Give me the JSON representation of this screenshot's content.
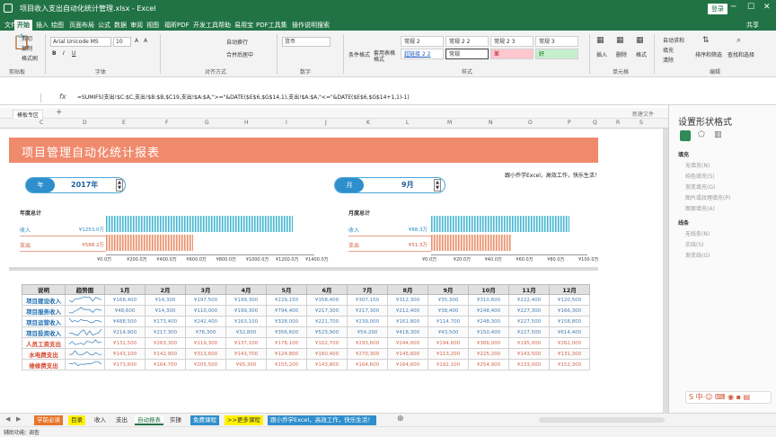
{
  "window": {
    "title": "项目收入支出自动化统计管理.xlsx  -  Excel",
    "login": "登录"
  },
  "tabs": [
    "文件",
    "开始",
    "插入",
    "绘图",
    "页面布局",
    "公式",
    "数据",
    "审阅",
    "视图",
    "福昕PDF",
    "开发工具",
    "帮助",
    "易用宝",
    "PDF工具集",
    "操作说明搜索"
  ],
  "tab_share": "共享",
  "ribbon": {
    "clipboard": {
      "cut": "剪切",
      "copy": "复制",
      "painter": "格式刷",
      "label": "剪贴板"
    },
    "font": {
      "name": "Arial Unicode MS",
      "size": "10",
      "label": "字体"
    },
    "align": {
      "wrap": "自动换行",
      "merge": "合并后居中",
      "label": "对齐方式"
    },
    "number": {
      "format": "货币",
      "label": "数字"
    },
    "styles": {
      "cond": "条件格式",
      "table": "套用表格格式",
      "cells": [
        [
          "常规 2",
          "常规 2 2",
          "常规 2 3",
          "常规 3"
        ],
        [
          "超链接 2 2",
          "常规",
          "差",
          "好"
        ]
      ],
      "label": "样式"
    },
    "cells_grp": {
      "insert": "插入",
      "delete": "删除",
      "format": "格式",
      "label": "单元格"
    },
    "edit": {
      "sum": "自动求和",
      "fill": "填充",
      "clear": "清除",
      "sort": "排序和筛选",
      "find": "查找和选择",
      "label": "编辑"
    }
  },
  "formula_bar": {
    "namebox": "",
    "fx": "fx",
    "formula": "=SUMIFS(支出!$C:$C,支出!$B:$B,$C19,支出!$A:$A,\">=\"&DATE($E$6,$G$14,1),支出!$A:$A,\"<=\"&DATE($E$6,$G$14+1,1)-1)"
  },
  "workbook_tabs": {
    "active": "模板专区",
    "new_sheet": "新建文件"
  },
  "columns": [
    "C",
    "D",
    "E",
    "F",
    "G",
    "H",
    "I",
    "J",
    "K",
    "L",
    "M",
    "N",
    "O",
    "P",
    "Q",
    "R",
    "S"
  ],
  "sheet": {
    "title": "项目管理自动化统计报表",
    "slogan": "跟小乔学Excel，高效工作，快乐生活！",
    "year_selector": {
      "label": "年",
      "value": "2017年"
    },
    "month_selector": {
      "label": "月",
      "value": "9月"
    },
    "annual": {
      "title": "年度总计",
      "income": {
        "label": "收入",
        "value": "¥1253.0万",
        "amount": 1253.0
      },
      "expense": {
        "label": "支出",
        "value": "¥588.2万",
        "amount": 588.2
      },
      "axis_max": 1400,
      "ticks": [
        "¥0.0万",
        "¥200.0万",
        "¥400.0万",
        "¥600.0万",
        "¥800.0万",
        "¥1000.0万",
        "¥1200.0万",
        "¥1400.0万"
      ]
    },
    "monthly": {
      "title": "月度总计",
      "income": {
        "label": "收入",
        "value": "¥88.3万",
        "amount": 88.3
      },
      "expense": {
        "label": "支出",
        "value": "¥51.3万",
        "amount": 51.3
      },
      "axis_max": 100,
      "ticks": [
        "¥0.0万",
        "¥20.0万",
        "¥40.0万",
        "¥60.0万",
        "¥80.0万",
        "¥100.0万"
      ]
    },
    "table": {
      "headers": [
        "说明",
        "趋势图",
        "1月",
        "2月",
        "3月",
        "4月",
        "5月",
        "6月",
        "7月",
        "8月",
        "9月",
        "10月",
        "11月",
        "12月"
      ],
      "rows": [
        {
          "name": "项目建设收入",
          "type": "in",
          "values": [
            "¥168,400",
            "¥14,300",
            "¥197,500",
            "¥199,300",
            "¥229,150",
            "¥358,400",
            "¥307,150",
            "¥312,300",
            "¥35,300",
            "¥310,600",
            "¥222,400",
            "¥120,500"
          ],
          "trend": [
            40,
            20,
            55,
            58,
            62,
            80,
            72,
            74,
            30,
            73,
            60,
            45
          ]
        },
        {
          "name": "项目服务收入",
          "type": "in",
          "values": [
            "¥48,600",
            "¥14,300",
            "¥110,000",
            "¥199,300",
            "¥794,400",
            "¥217,300",
            "¥217,300",
            "¥212,400",
            "¥38,400",
            "¥248,400",
            "¥227,300",
            "¥166,300"
          ],
          "trend": [
            30,
            20,
            45,
            60,
            85,
            62,
            62,
            60,
            28,
            64,
            62,
            50
          ]
        },
        {
          "name": "项目运营收入",
          "type": "in",
          "values": [
            "¥488,500",
            "¥173,400",
            "¥242,400",
            "¥163,100",
            "¥328,000",
            "¥221,700",
            "¥239,000",
            "¥161,800",
            "¥114,700",
            "¥248,300",
            "¥227,500",
            "¥158,800"
          ],
          "trend": [
            85,
            45,
            60,
            42,
            72,
            56,
            58,
            40,
            32,
            60,
            56,
            40
          ]
        },
        {
          "name": "项目投资收入",
          "type": "in",
          "values": [
            "¥214,900",
            "¥217,300",
            "¥76,300",
            "¥32,800",
            "¥356,600",
            "¥523,900",
            "¥54,200",
            "¥418,300",
            "¥43,500",
            "¥150,400",
            "¥227,500",
            "¥614,400"
          ],
          "trend": [
            40,
            42,
            20,
            12,
            58,
            80,
            18,
            66,
            15,
            30,
            42,
            90
          ]
        },
        {
          "name": "人员工资支出",
          "type": "out",
          "values": [
            "¥131,500",
            "¥263,300",
            "¥119,300",
            "¥137,100",
            "¥178,100",
            "¥102,700",
            "¥293,600",
            "¥244,000",
            "¥194,600",
            "¥366,000",
            "¥195,000",
            "¥262,000"
          ],
          "trend": [
            30,
            58,
            26,
            32,
            42,
            24,
            62,
            54,
            44,
            75,
            44,
            56
          ]
        },
        {
          "name": "水电费支出",
          "type": "out",
          "values": [
            "¥143,100",
            "¥142,900",
            "¥313,600",
            "¥143,700",
            "¥124,800",
            "¥160,400",
            "¥270,300",
            "¥145,600",
            "¥113,200",
            "¥225,200",
            "¥143,500",
            "¥131,300"
          ],
          "trend": [
            34,
            34,
            70,
            34,
            30,
            38,
            60,
            35,
            28,
            52,
            34,
            32
          ]
        },
        {
          "name": "维修费支出",
          "type": "out",
          "values": [
            "¥173,600",
            "¥164,700",
            "¥205,500",
            "¥95,300",
            "¥155,200",
            "¥143,800",
            "¥164,600",
            "¥164,600",
            "¥192,100",
            "¥254,900",
            "¥233,000",
            "¥152,300"
          ],
          "trend": [
            42,
            40,
            50,
            25,
            38,
            35,
            40,
            40,
            46,
            60,
            56,
            37
          ]
        }
      ]
    }
  },
  "sheet_tabs": [
    "学前必读",
    "目录",
    "收入",
    "支出",
    "自动报表",
    "实操",
    "免费课程",
    ">>更多课程",
    "跟小乔学Excel，高效工作，快乐生活！"
  ],
  "status": "辅助功能: 调查",
  "pane": {
    "title": "设置形状格式",
    "fill_head": "填充",
    "fill_items": [
      "无填充(N)",
      "纯色填充(S)",
      "渐变填充(G)",
      "图片或纹理填充(P)",
      "图案填充(A)"
    ],
    "line_head": "线条",
    "line_items": [
      "无线条(N)",
      "实线(S)",
      "渐变线(G)"
    ]
  },
  "colors": {
    "excel_green": "#217346",
    "banner": "#f08a6c",
    "income": "#49b6cf",
    "expense": "#e9926f"
  }
}
